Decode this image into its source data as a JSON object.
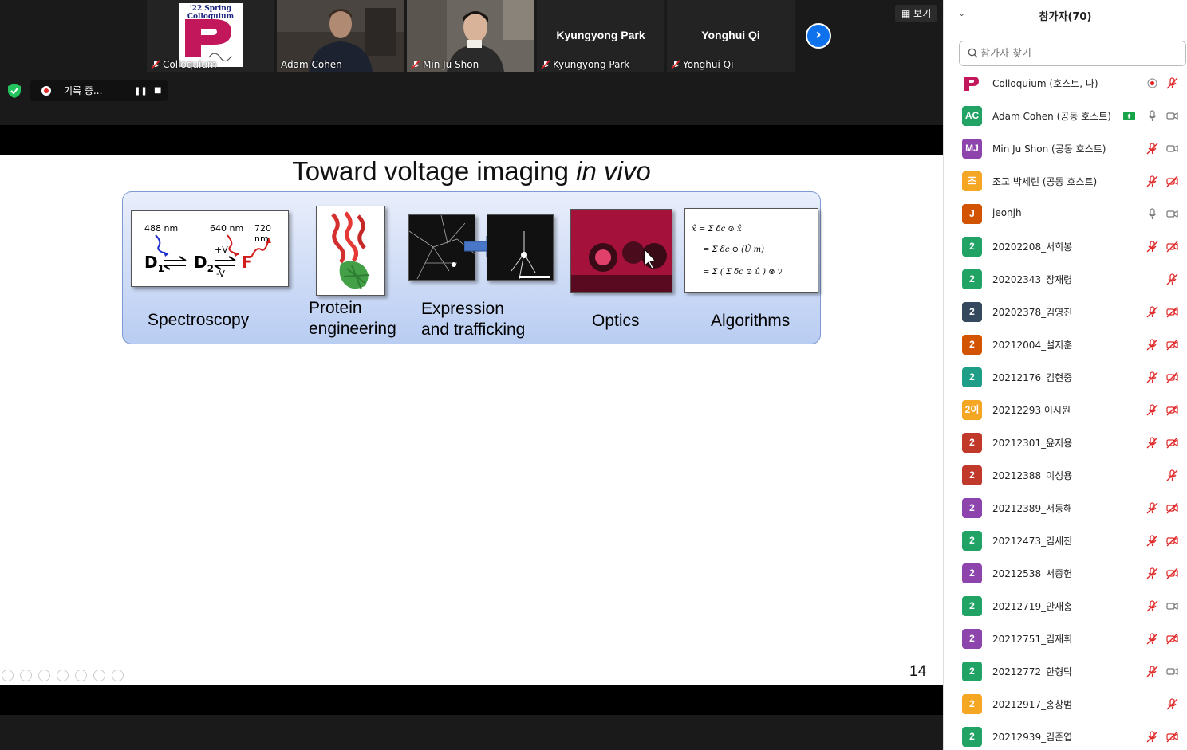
{
  "window": {
    "view_button": "보기",
    "recording_label": "기록 중..."
  },
  "gallery": {
    "tiles": [
      {
        "name": "Colloquium",
        "logo_text": "'22 Spring Colloquium",
        "type": "logo"
      },
      {
        "name": "Adam Cohen",
        "type": "video",
        "active": true
      },
      {
        "name": "Min Ju Shon",
        "type": "video"
      },
      {
        "name": "Kyungyong Park",
        "display_name": "Kyungyong Park",
        "type": "name"
      },
      {
        "name": "Yonghui Qi",
        "display_name": "Yonghui Qi",
        "type": "name"
      }
    ]
  },
  "slide": {
    "title_main": "Toward voltage imaging ",
    "title_italic": "in vivo",
    "page_number": "14",
    "panels": [
      {
        "label": "Spectroscopy"
      },
      {
        "label_line1": "Protein",
        "label_line2": "engineering"
      },
      {
        "label_line1": "Expression",
        "label_line2": "and trafficking"
      },
      {
        "label": "Optics"
      },
      {
        "label": "Algorithms"
      }
    ],
    "spectroscopy": {
      "wl1": "488 nm",
      "wl2": "640 nm",
      "wl3": "720 nm",
      "d1": "D",
      "d1_sub": "1",
      "d2": "D",
      "d2_sub": "2",
      "f": "F",
      "plus_v": "+V",
      "minus_v": "-V"
    }
  },
  "participants": {
    "header": "참가자(70)",
    "search_placeholder": "참가자 찾기",
    "colors": {
      "green": "#21a366",
      "teal": "#1e9e86",
      "purple": "#8e44ad",
      "orange": "#f5a623",
      "dorange": "#d35400",
      "red": "#c0392b",
      "navy": "#34495e",
      "muted_icon": "#e02828"
    },
    "list": [
      {
        "avatar": "",
        "avatar_type": "logo",
        "name": "Colloquium (호스트, 나)",
        "icons": [
          "record-icon",
          "mic-off-icon"
        ]
      },
      {
        "avatar": "AC",
        "color": "green",
        "name": "Adam Cohen (공동 호스트)",
        "icons": [
          "share-screen-icon",
          "mic-on-icon",
          "video-on-icon"
        ]
      },
      {
        "avatar": "MJ",
        "color": "purple",
        "name": "Min Ju Shon (공동 호스트)",
        "icons": [
          "mic-off-icon",
          "video-on-icon"
        ]
      },
      {
        "avatar": "조",
        "color": "orange",
        "name": "조교 박세린 (공동 호스트)",
        "icons": [
          "mic-off-icon",
          "video-off-icon"
        ]
      },
      {
        "avatar": "J",
        "color": "dorange",
        "name": "jeonjh",
        "icons": [
          "mic-on-icon",
          "video-on-icon"
        ]
      },
      {
        "avatar": "2",
        "color": "green",
        "name": "20202208_서희봉",
        "icons": [
          "mic-off-icon",
          "video-off-icon"
        ]
      },
      {
        "avatar": "2",
        "color": "green",
        "name": "20202343_장재령",
        "icons": [
          "mic-off-icon"
        ]
      },
      {
        "avatar": "2",
        "color": "navy",
        "name": "20202378_김영진",
        "icons": [
          "mic-off-icon",
          "video-off-icon"
        ]
      },
      {
        "avatar": "2",
        "color": "dorange",
        "name": "20212004_설지훈",
        "icons": [
          "mic-off-icon",
          "video-off-icon"
        ]
      },
      {
        "avatar": "2",
        "color": "teal",
        "name": "20212176_김현중",
        "icons": [
          "mic-off-icon",
          "video-off-icon"
        ]
      },
      {
        "avatar": "2이",
        "color": "orange",
        "name": "20212293 이시원",
        "icons": [
          "mic-off-icon",
          "video-off-icon"
        ]
      },
      {
        "avatar": "2",
        "color": "red",
        "name": "20212301_윤지용",
        "icons": [
          "mic-off-icon",
          "video-off-icon"
        ]
      },
      {
        "avatar": "2",
        "color": "red",
        "name": "20212388_이성용",
        "icons": [
          "mic-off-icon"
        ]
      },
      {
        "avatar": "2",
        "color": "purple",
        "name": "20212389_서동해",
        "icons": [
          "mic-off-icon",
          "video-off-icon"
        ]
      },
      {
        "avatar": "2",
        "color": "green",
        "name": "20212473_김세진",
        "icons": [
          "mic-off-icon",
          "video-off-icon"
        ]
      },
      {
        "avatar": "2",
        "color": "purple",
        "name": "20212538_서종헌",
        "icons": [
          "mic-off-icon",
          "video-off-icon"
        ]
      },
      {
        "avatar": "2",
        "color": "green",
        "name": "20212719_안재홍",
        "icons": [
          "mic-off-icon",
          "video-on-icon"
        ]
      },
      {
        "avatar": "2",
        "color": "purple",
        "name": "20212751_김재휘",
        "icons": [
          "mic-off-icon",
          "video-off-icon"
        ]
      },
      {
        "avatar": "2",
        "color": "green",
        "name": "20212772_한형탁",
        "icons": [
          "mic-off-icon",
          "video-on-icon"
        ]
      },
      {
        "avatar": "2",
        "color": "orange",
        "name": "20212917_홍창범",
        "icons": [
          "mic-off-icon"
        ]
      },
      {
        "avatar": "2",
        "color": "green",
        "name": "20212939_김준엽",
        "icons": [
          "mic-off-icon",
          "video-off-icon"
        ]
      }
    ]
  }
}
